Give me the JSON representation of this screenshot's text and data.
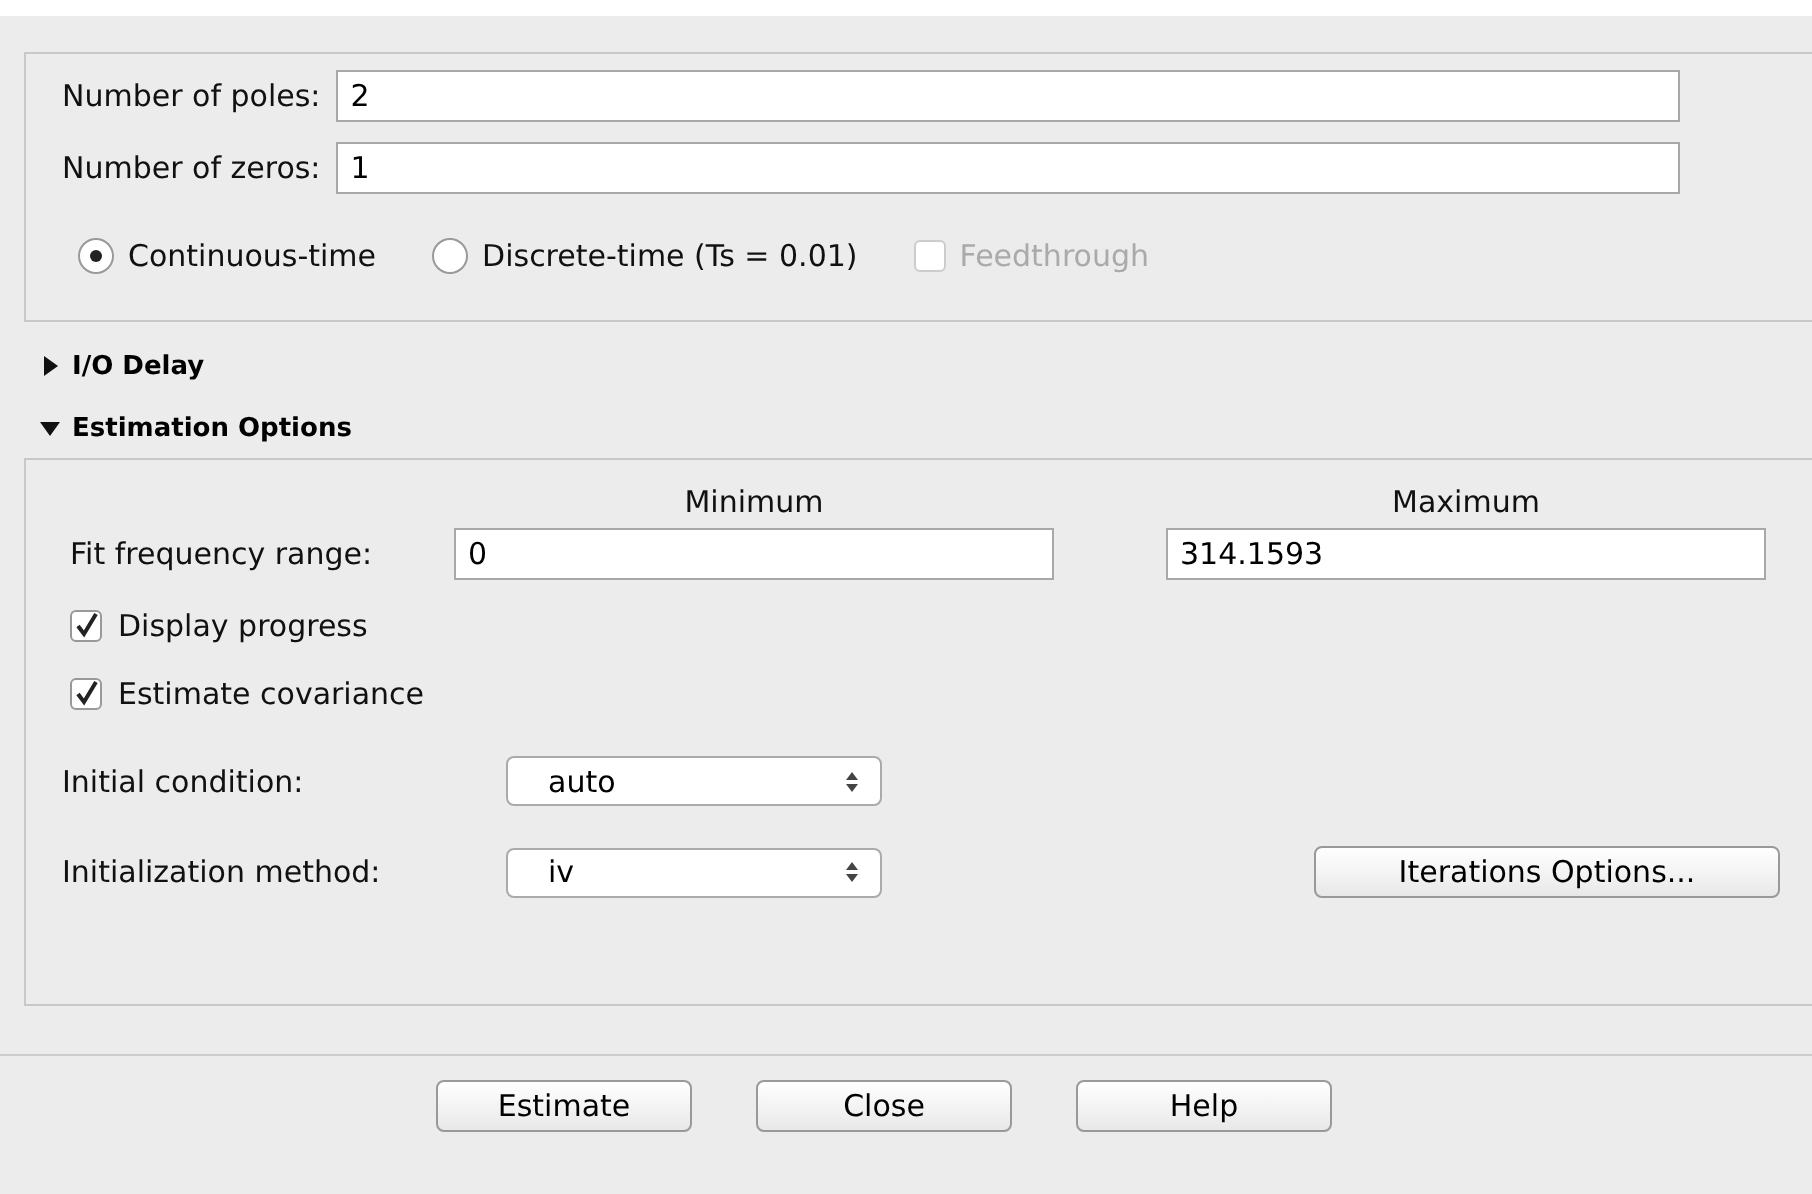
{
  "model_fields": [
    {
      "label": "Number of poles:",
      "value": "2"
    },
    {
      "label": "Number of zeros:",
      "value": "1"
    }
  ],
  "time_domain": [
    {
      "label": "Continuous-time",
      "selected": true
    },
    {
      "label": "Discrete-time (Ts = 0.01)",
      "selected": false
    }
  ],
  "feedthrough": {
    "label": "Feedthrough",
    "checked": false,
    "disabled": true
  },
  "io_delay": {
    "label": "I/O Delay",
    "expanded": false
  },
  "estimation_options": {
    "label": "Estimation Options",
    "expanded": true,
    "range_headers": [
      "Minimum",
      "Maximum"
    ],
    "fit_frequency_range": {
      "label": "Fit frequency range:",
      "minimum": "0",
      "maximum": "314.1593"
    },
    "checkboxes": [
      {
        "label": "Display progress",
        "checked": true
      },
      {
        "label": "Estimate covariance",
        "checked": true
      }
    ],
    "dropdowns": [
      {
        "label": "Initial condition:",
        "value": "auto"
      },
      {
        "label": "Initialization method:",
        "value": "iv"
      }
    ],
    "iterations_button": "Iterations Options..."
  },
  "buttons": [
    "Estimate",
    "Close",
    "Help"
  ]
}
